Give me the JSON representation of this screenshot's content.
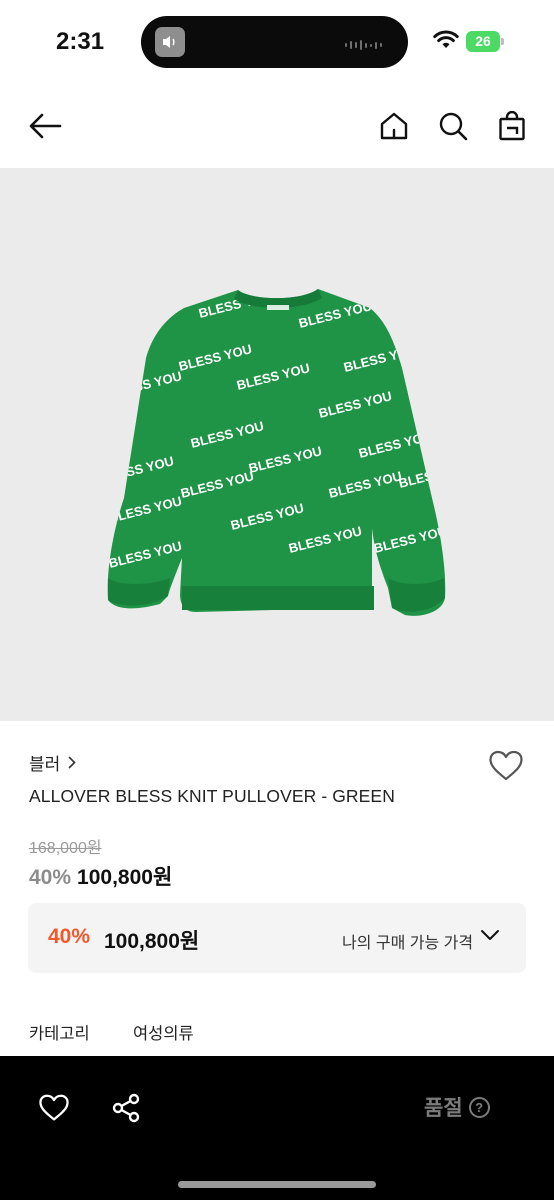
{
  "status_bar": {
    "time": "2:31",
    "battery": "26"
  },
  "nav": {
    "back_icon": "arrow-left-icon",
    "home_icon": "home-icon",
    "search_icon": "search-icon",
    "bag_icon": "shopping-bag-icon"
  },
  "product": {
    "brand": "블러",
    "brand_chevron": "›",
    "title": "ALLOVER BLESS KNIT PULLOVER - GREEN",
    "original_price": "168,000원",
    "discount": "40%",
    "sale_price": "100,800원",
    "image_text": "BLESS YOU",
    "colors": {
      "sweater": "#1f9446",
      "background": "#ebebeb"
    }
  },
  "my_price": {
    "discount": "40%",
    "price": "100,800원",
    "label": "나의 구매 가능 가격",
    "accent_color": "#f1582a"
  },
  "category": {
    "label": "카테고리",
    "value": "여성의류"
  },
  "bottom_bar": {
    "wish_icon": "heart-icon",
    "share_icon": "share-icon",
    "status": "품절",
    "help": "?"
  }
}
